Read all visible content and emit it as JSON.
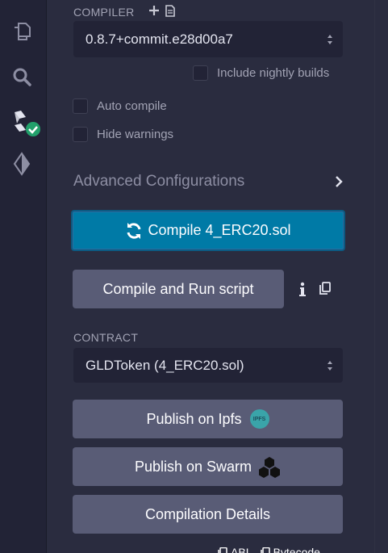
{
  "iconbar": {
    "items": [
      {
        "name": "file-explorer-icon"
      },
      {
        "name": "search-icon"
      },
      {
        "name": "solidity-compiler-icon"
      },
      {
        "name": "deploy-run-icon"
      }
    ]
  },
  "compiler": {
    "label": "COMPILER",
    "version": "0.8.7+commit.e28d00a7",
    "nightly_label": "Include nightly builds",
    "auto_compile_label": "Auto compile",
    "hide_warnings_label": "Hide warnings",
    "advanced_label": "Advanced Configurations",
    "compile_button": "Compile 4_ERC20.sol",
    "compile_run_button": "Compile and Run script"
  },
  "contract": {
    "label": "CONTRACT",
    "selected": "GLDToken (4_ERC20.sol)"
  },
  "actions": {
    "publish_ipfs": "Publish on Ipfs",
    "ipfs_badge": "IPFS",
    "publish_swarm": "Publish on Swarm",
    "compilation_details": "Compilation Details",
    "abi_link": "ABI",
    "bytecode_link": "Bytecode"
  },
  "colors": {
    "accent": "#007aa6",
    "success": "#22a06b",
    "panel_bg": "#2a2c3f",
    "button_grey": "#595c76"
  }
}
